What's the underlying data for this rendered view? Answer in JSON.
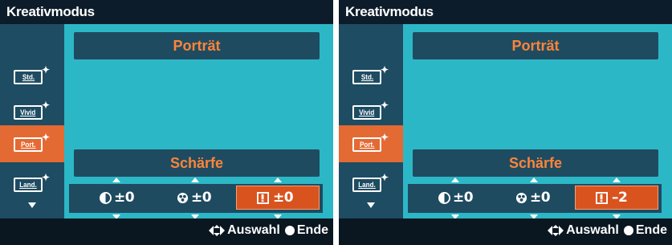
{
  "screens": [
    {
      "title": "Kreativmodus",
      "style_name": "Porträt",
      "param_name": "Schärfe",
      "sidebar": {
        "items": [
          {
            "label": "Std.",
            "selected": false
          },
          {
            "label": "Vivid",
            "selected": false
          },
          {
            "label": "Port.",
            "selected": true
          },
          {
            "label": "Land.",
            "selected": false
          }
        ]
      },
      "params": [
        {
          "icon": "contrast-icon",
          "value": "±0",
          "selected": false
        },
        {
          "icon": "saturation-icon",
          "value": "±0",
          "selected": false
        },
        {
          "icon": "sharpness-icon",
          "value": "±0",
          "selected": true
        }
      ],
      "footer": {
        "select_label": "Auswahl",
        "end_label": "Ende"
      }
    },
    {
      "title": "Kreativmodus",
      "style_name": "Porträt",
      "param_name": "Schärfe",
      "sidebar": {
        "items": [
          {
            "label": "Std.",
            "selected": false
          },
          {
            "label": "Vivid",
            "selected": false
          },
          {
            "label": "Port.",
            "selected": true
          },
          {
            "label": "Land.",
            "selected": false
          }
        ]
      },
      "params": [
        {
          "icon": "contrast-icon",
          "value": "±0",
          "selected": false
        },
        {
          "icon": "saturation-icon",
          "value": "±0",
          "selected": false
        },
        {
          "icon": "sharpness-icon",
          "value": "–2",
          "selected": true
        }
      ],
      "footer": {
        "select_label": "Auswahl",
        "end_label": "Ende"
      }
    }
  ],
  "colors": {
    "accent": "#e46a34",
    "panel": "#1f4b61",
    "background": "#2cb7c6",
    "label_orange": "#ff8438"
  }
}
